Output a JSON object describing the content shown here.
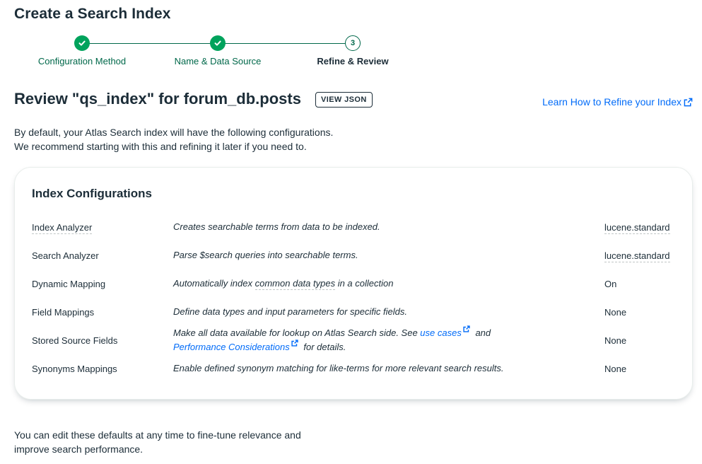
{
  "page": {
    "title": "Create a Search Index"
  },
  "stepper": {
    "steps": [
      {
        "label": "Configuration Method",
        "status": "done"
      },
      {
        "label": "Name & Data Source",
        "status": "done"
      },
      {
        "label": "Refine & Review",
        "status": "current",
        "number": "3"
      }
    ]
  },
  "review": {
    "heading": "Review \"qs_index\" for forum_db.posts",
    "view_json_label": "VIEW JSON",
    "learn_link": "Learn How to Refine your Index",
    "intro_line1": "By default, your Atlas Search index will have the following configurations.",
    "intro_line2": "We recommend starting with this and refining it later if you need to."
  },
  "card": {
    "title": "Index Configurations",
    "rows": [
      {
        "name": "Index Analyzer",
        "description": "Creates searchable terms from data to be indexed.",
        "value": "lucene.standard"
      },
      {
        "name": "Search Analyzer",
        "description": "Parse $search queries into searchable terms.",
        "value": "lucene.standard"
      },
      {
        "name": "Dynamic Mapping",
        "desc_pre": "Automatically index ",
        "desc_term": "common data types",
        "desc_post": " in a collection",
        "value": "On"
      },
      {
        "name": "Field Mappings",
        "description": "Define data types and input parameters for specific fields.",
        "value": "None"
      },
      {
        "name": "Stored Source Fields",
        "desc_pre": "Make all data available for lookup on Atlas Search side. See ",
        "link1": "use cases",
        "desc_mid": " and",
        "link2": "Performance Considerations",
        "desc_post": " for details.",
        "value": "None"
      },
      {
        "name": "Synonyms Mappings",
        "description": "Enable defined synonym matching for like-terms for more relevant search results.",
        "value": "None"
      }
    ]
  },
  "footer": {
    "line1": "You can edit these defaults at any time to fine-tune relevance and",
    "line2": "improve search performance."
  },
  "colors": {
    "primary_green": "#00684a",
    "check_green": "#00a35c",
    "link_blue": "#016bf8",
    "text": "#1c2d38"
  }
}
